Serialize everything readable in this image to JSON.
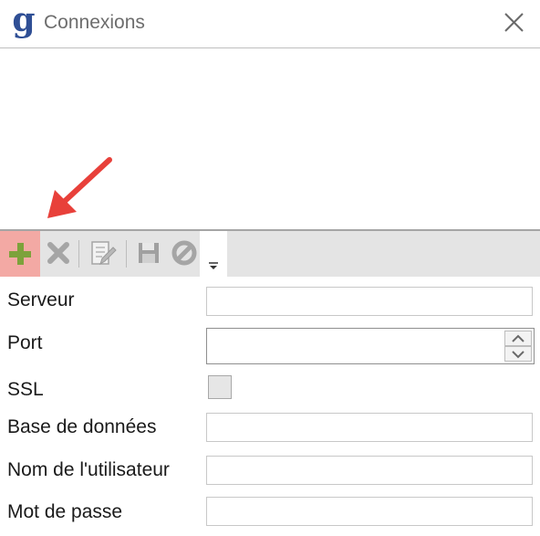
{
  "window": {
    "title": "Connexions",
    "logo_letter": "g",
    "logo_color": "#2f4f95"
  },
  "toolbar": {
    "buttons": [
      {
        "name": "add",
        "icon": "plus-icon",
        "enabled": true,
        "highlighted": true
      },
      {
        "name": "delete",
        "icon": "x-icon",
        "enabled": false
      },
      {
        "name": "edit",
        "icon": "edit-icon",
        "enabled": false
      },
      {
        "name": "save",
        "icon": "floppy-icon",
        "enabled": false
      },
      {
        "name": "cancel",
        "icon": "cancel-icon",
        "enabled": false
      }
    ],
    "highlight_color": "#f3a9a4"
  },
  "annotation": {
    "type": "arrow",
    "color": "#e8403a"
  },
  "form": {
    "server": {
      "label": "Serveur",
      "value": ""
    },
    "port": {
      "label": "Port",
      "value": ""
    },
    "ssl": {
      "label": "SSL",
      "checked": false
    },
    "database": {
      "label": "Base de données",
      "value": ""
    },
    "username": {
      "label": "Nom de l'utilisateur",
      "value": ""
    },
    "password": {
      "label": "Mot de passe",
      "value": ""
    }
  }
}
